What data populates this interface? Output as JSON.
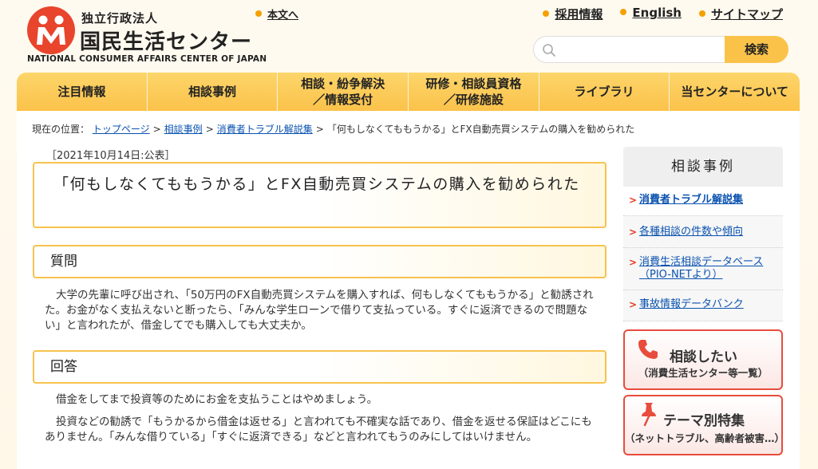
{
  "header": {
    "org_type": "独立行政法人",
    "org_name": "国民生活センター",
    "org_name_en": "NATIONAL CONSUMER AFFAIRS CENTER OF JAPAN",
    "skip_link": "本文へ",
    "util_links": [
      "採用情報",
      "English",
      "サイトマップ"
    ],
    "search_placeholder": "",
    "search_button": "検索"
  },
  "nav": [
    {
      "line1": "注目情報",
      "line2": ""
    },
    {
      "line1": "相談事例",
      "line2": ""
    },
    {
      "line1": "相談・紛争解決",
      "line2": "／情報受付"
    },
    {
      "line1": "研修・相談員資格",
      "line2": "／研修施設"
    },
    {
      "line1": "ライブラリ",
      "line2": ""
    },
    {
      "line1": "当センターについて",
      "line2": ""
    }
  ],
  "breadcrumb": {
    "prefix": "現在の位置：",
    "items": [
      "トップページ",
      "相談事例",
      "消費者トラブル解説集"
    ],
    "current": "「何もしなくてももうかる」とFX自動売買システムの購入を勧められた"
  },
  "article": {
    "date": "［2021年10月14日:公表］",
    "title": "「何もしなくてももうかる」とFX自動売買システムの購入を勧められた",
    "question_heading": "質問",
    "question_text": "大学の先輩に呼び出され、「50万円のFX自動売買システムを購入すれば、何もしなくてももうかる」と勧誘された。お金がなく支払えないと断ったら、「みんな学生ローンで借りて支払っている。すぐに返済できるので問題ない」と言われたが、借金してでも購入しても大丈夫か。",
    "answer_heading": "回答",
    "answer_text_1": "借金をしてまで投資等のためにお金を支払うことはやめましょう。",
    "answer_text_2": "投資などの勧誘で「もうかるから借金は返せる」と言われても不確実な話であり、借金を返せる保証はどこにもありません。「みんな借りている」「すぐに返済できる」などと言われてもうのみにしてはいけません。"
  },
  "sidebar": {
    "heading": "相談事例",
    "items": [
      {
        "label": "消費者トラブル解説集",
        "active": true
      },
      {
        "label": "各種相談の件数や傾向",
        "active": false
      },
      {
        "label": "消費生活相談データベース（PIO-NETより）",
        "active": false
      },
      {
        "label": "事故情報データバンク",
        "active": false
      }
    ]
  },
  "banners": [
    {
      "title": "相談したい",
      "sub": "（消費生活センター等一覧）",
      "icon": "phone-icon"
    },
    {
      "title": "テーマ別特集",
      "sub": "（ネットトラブル、高齢者被害…）",
      "icon": "pushpin-icon"
    }
  ],
  "colors": {
    "accent": "#fbc24a",
    "brand": "#e8452c",
    "link": "#0a52b0"
  }
}
